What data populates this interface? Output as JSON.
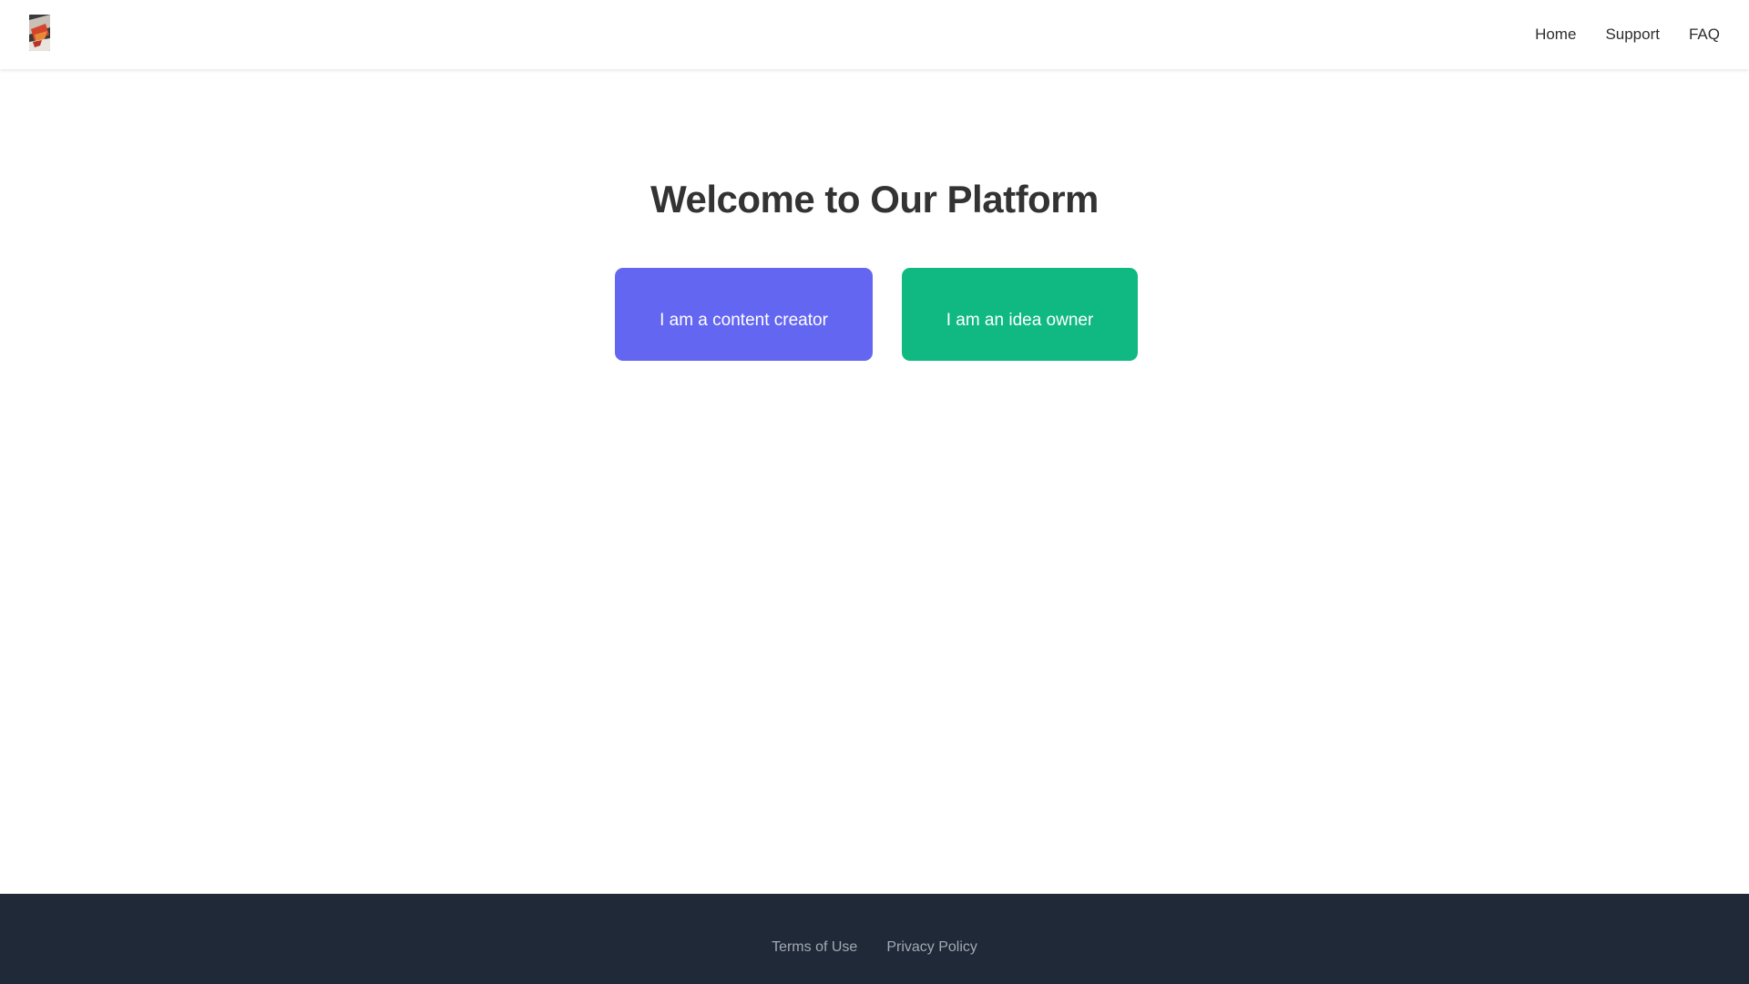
{
  "header": {
    "logo_icon": "logo-image-icon",
    "nav": [
      {
        "label": "Home"
      },
      {
        "label": "Support"
      },
      {
        "label": "FAQ"
      }
    ]
  },
  "main": {
    "title": "Welcome to Our Platform",
    "choices": [
      {
        "label": "I am a content creator",
        "color": "#6366f1"
      },
      {
        "label": "I am an idea owner",
        "color": "#10b981"
      }
    ]
  },
  "footer": {
    "background": "#1f2937",
    "links": [
      {
        "label": "Terms of Use"
      },
      {
        "label": "Privacy Policy"
      }
    ]
  }
}
